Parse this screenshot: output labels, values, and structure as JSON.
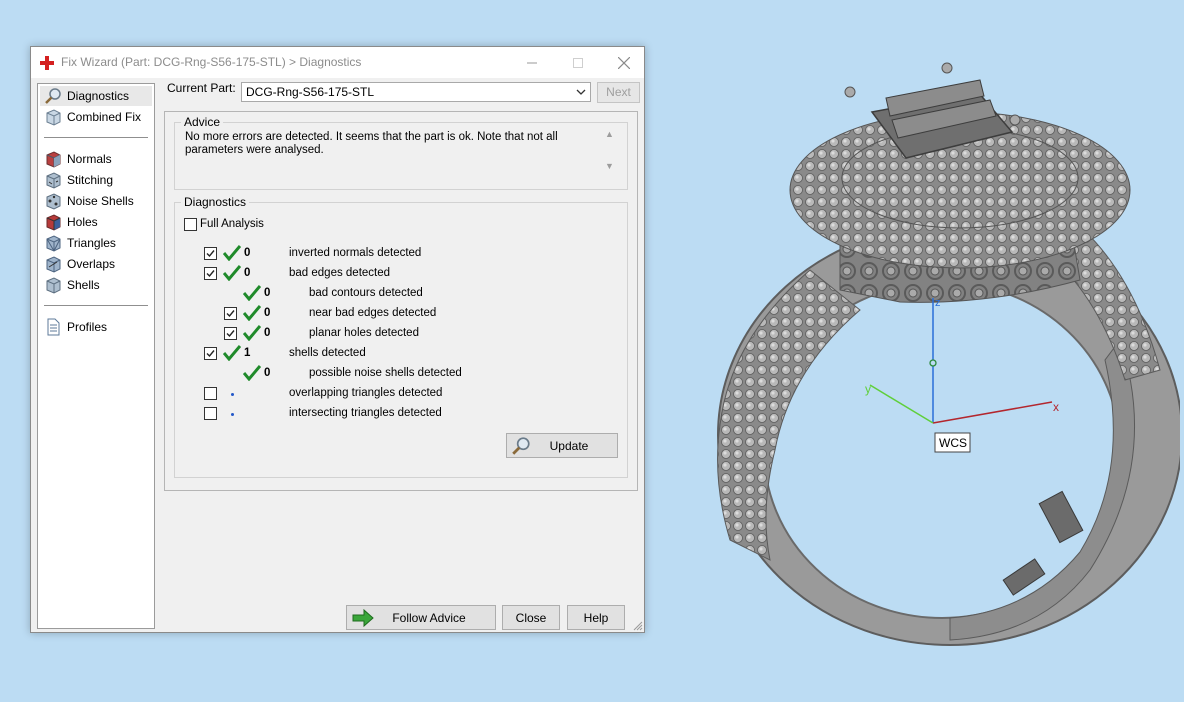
{
  "window": {
    "title": "Fix Wizard (Part: DCG-Rng-S56-175-STL) > Diagnostics"
  },
  "sidebar": {
    "items": [
      {
        "label": "Diagnostics",
        "icon": "magnifier-icon",
        "selected": true
      },
      {
        "label": "Combined Fix",
        "icon": "cube-icon"
      },
      {
        "label": "Normals",
        "icon": "normals-cube-icon"
      },
      {
        "label": "Stitching",
        "icon": "stitching-cube-icon"
      },
      {
        "label": "Noise Shells",
        "icon": "noise-shells-icon"
      },
      {
        "label": "Holes",
        "icon": "holes-cube-icon"
      },
      {
        "label": "Triangles",
        "icon": "triangles-cube-icon"
      },
      {
        "label": "Overlaps",
        "icon": "overlaps-cube-icon"
      },
      {
        "label": "Shells",
        "icon": "shells-cube-icon"
      },
      {
        "label": "Profiles",
        "icon": "document-icon"
      }
    ]
  },
  "current_part": {
    "label": "Current Part:",
    "value": "DCG-Rng-S56-175-STL",
    "next_label": "Next"
  },
  "advice": {
    "title": "Advice",
    "text": "No more errors are detected. It seems that the part is ok. Note that not all parameters were analysed."
  },
  "diagnostics": {
    "title": "Diagnostics",
    "full_analysis_label": "Full Analysis",
    "full_analysis_checked": false,
    "rows": [
      {
        "checked": true,
        "status": "ok",
        "count": "0",
        "label": "inverted normals detected"
      },
      {
        "checked": true,
        "status": "ok",
        "count": "0",
        "label": "bad edges detected"
      },
      {
        "checked": null,
        "status": "ok",
        "count": "0",
        "label": "bad contours detected"
      },
      {
        "checked": true,
        "status": "ok",
        "count": "0",
        "label": "near bad edges detected"
      },
      {
        "checked": true,
        "status": "ok",
        "count": "0",
        "label": "planar holes detected"
      },
      {
        "checked": true,
        "status": "ok",
        "count": "1",
        "label": "shells detected"
      },
      {
        "checked": null,
        "status": "ok",
        "count": "0",
        "label": "possible noise shells detected"
      },
      {
        "checked": false,
        "status": "pending",
        "count": "",
        "label": "overlapping triangles detected"
      },
      {
        "checked": false,
        "status": "pending",
        "count": "",
        "label": "intersecting triangles detected"
      }
    ],
    "update_label": "Update"
  },
  "footer": {
    "follow_advice_label": "Follow Advice",
    "close_label": "Close",
    "help_label": "Help"
  },
  "viewport": {
    "axis_x": "x",
    "axis_y": "y",
    "axis_z": "z",
    "wcs_label": "WCS"
  },
  "colors": {
    "desktop": "#bcdcf3",
    "check_green": "#1f8a2a",
    "axis_x": "#b3262d",
    "axis_y": "#5fcf3a",
    "axis_z": "#2a6ed8",
    "ring_metal": "#8f8f8f"
  }
}
